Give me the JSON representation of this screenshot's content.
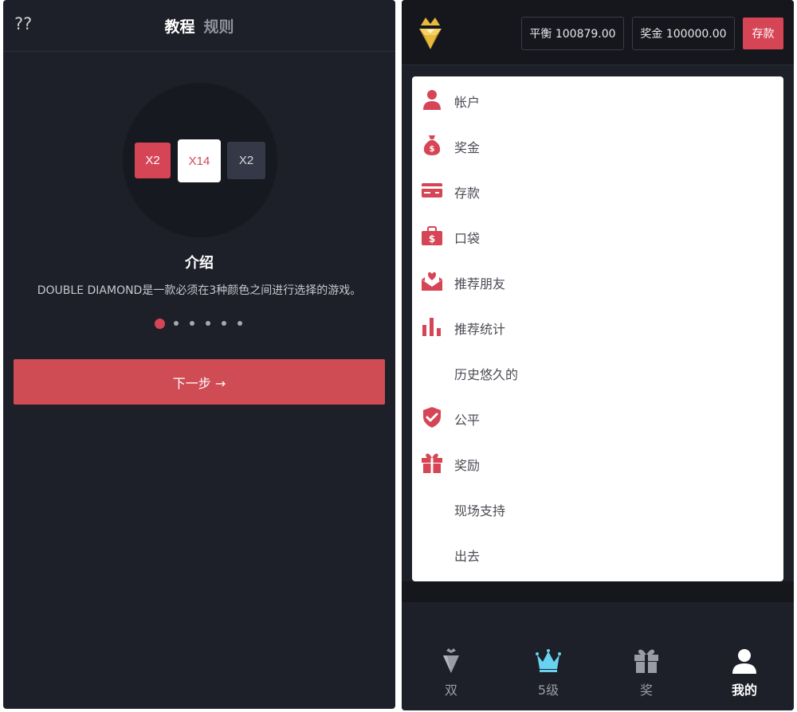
{
  "colors": {
    "accent": "#d64556",
    "panel_bg": "#1e2029",
    "header_bg": "#15171c",
    "card_bg": "#ffffff",
    "nav_active": "#69d2f0"
  },
  "tutorial": {
    "help_mark": "??",
    "tabs": [
      {
        "label": "教程",
        "active": true
      },
      {
        "label": "规则",
        "active": false
      }
    ],
    "tiles": {
      "left": "X2",
      "center": "X14",
      "right": "X2"
    },
    "intro_title": "介绍",
    "intro_text": "DOUBLE DIAMOND是一款必须在3种颜色之间进行选择的游戏。",
    "pagination": {
      "total": 6,
      "current": 1
    },
    "next_button": "下一步 →"
  },
  "account": {
    "logo_icon": "gold-diamond-crown-icon",
    "balance": {
      "label": "平衡",
      "value": "100879.00"
    },
    "bonus": {
      "label": "奖金",
      "value": "100000.00"
    },
    "balance_text": "平衡 100879.00",
    "bonus_text": "奖金 100000.00",
    "deposit_button": "存款",
    "menu": [
      {
        "label": "帐户",
        "icon": "user-icon"
      },
      {
        "label": "奖金",
        "icon": "money-bag-icon"
      },
      {
        "label": "存款",
        "icon": "credit-card-icon"
      },
      {
        "label": "口袋",
        "icon": "wallet-bag-icon"
      },
      {
        "label": "推荐朋友",
        "icon": "envelope-heart-icon"
      },
      {
        "label": "推荐统计",
        "icon": "bar-chart-icon"
      },
      {
        "label": "历史悠久的",
        "icon": ""
      },
      {
        "label": "公平",
        "icon": "shield-check-icon"
      },
      {
        "label": "奖励",
        "icon": "gift-icon"
      },
      {
        "label": "现场支持",
        "icon": ""
      },
      {
        "label": "出去",
        "icon": ""
      }
    ],
    "bottom_nav": [
      {
        "label": "双",
        "icon": "diamond-icon",
        "active": false
      },
      {
        "label": "5级",
        "icon": "crown-icon",
        "active": false
      },
      {
        "label": "奖",
        "icon": "gift-icon",
        "active": false
      },
      {
        "label": "我的",
        "icon": "user-icon",
        "active": true
      }
    ]
  }
}
